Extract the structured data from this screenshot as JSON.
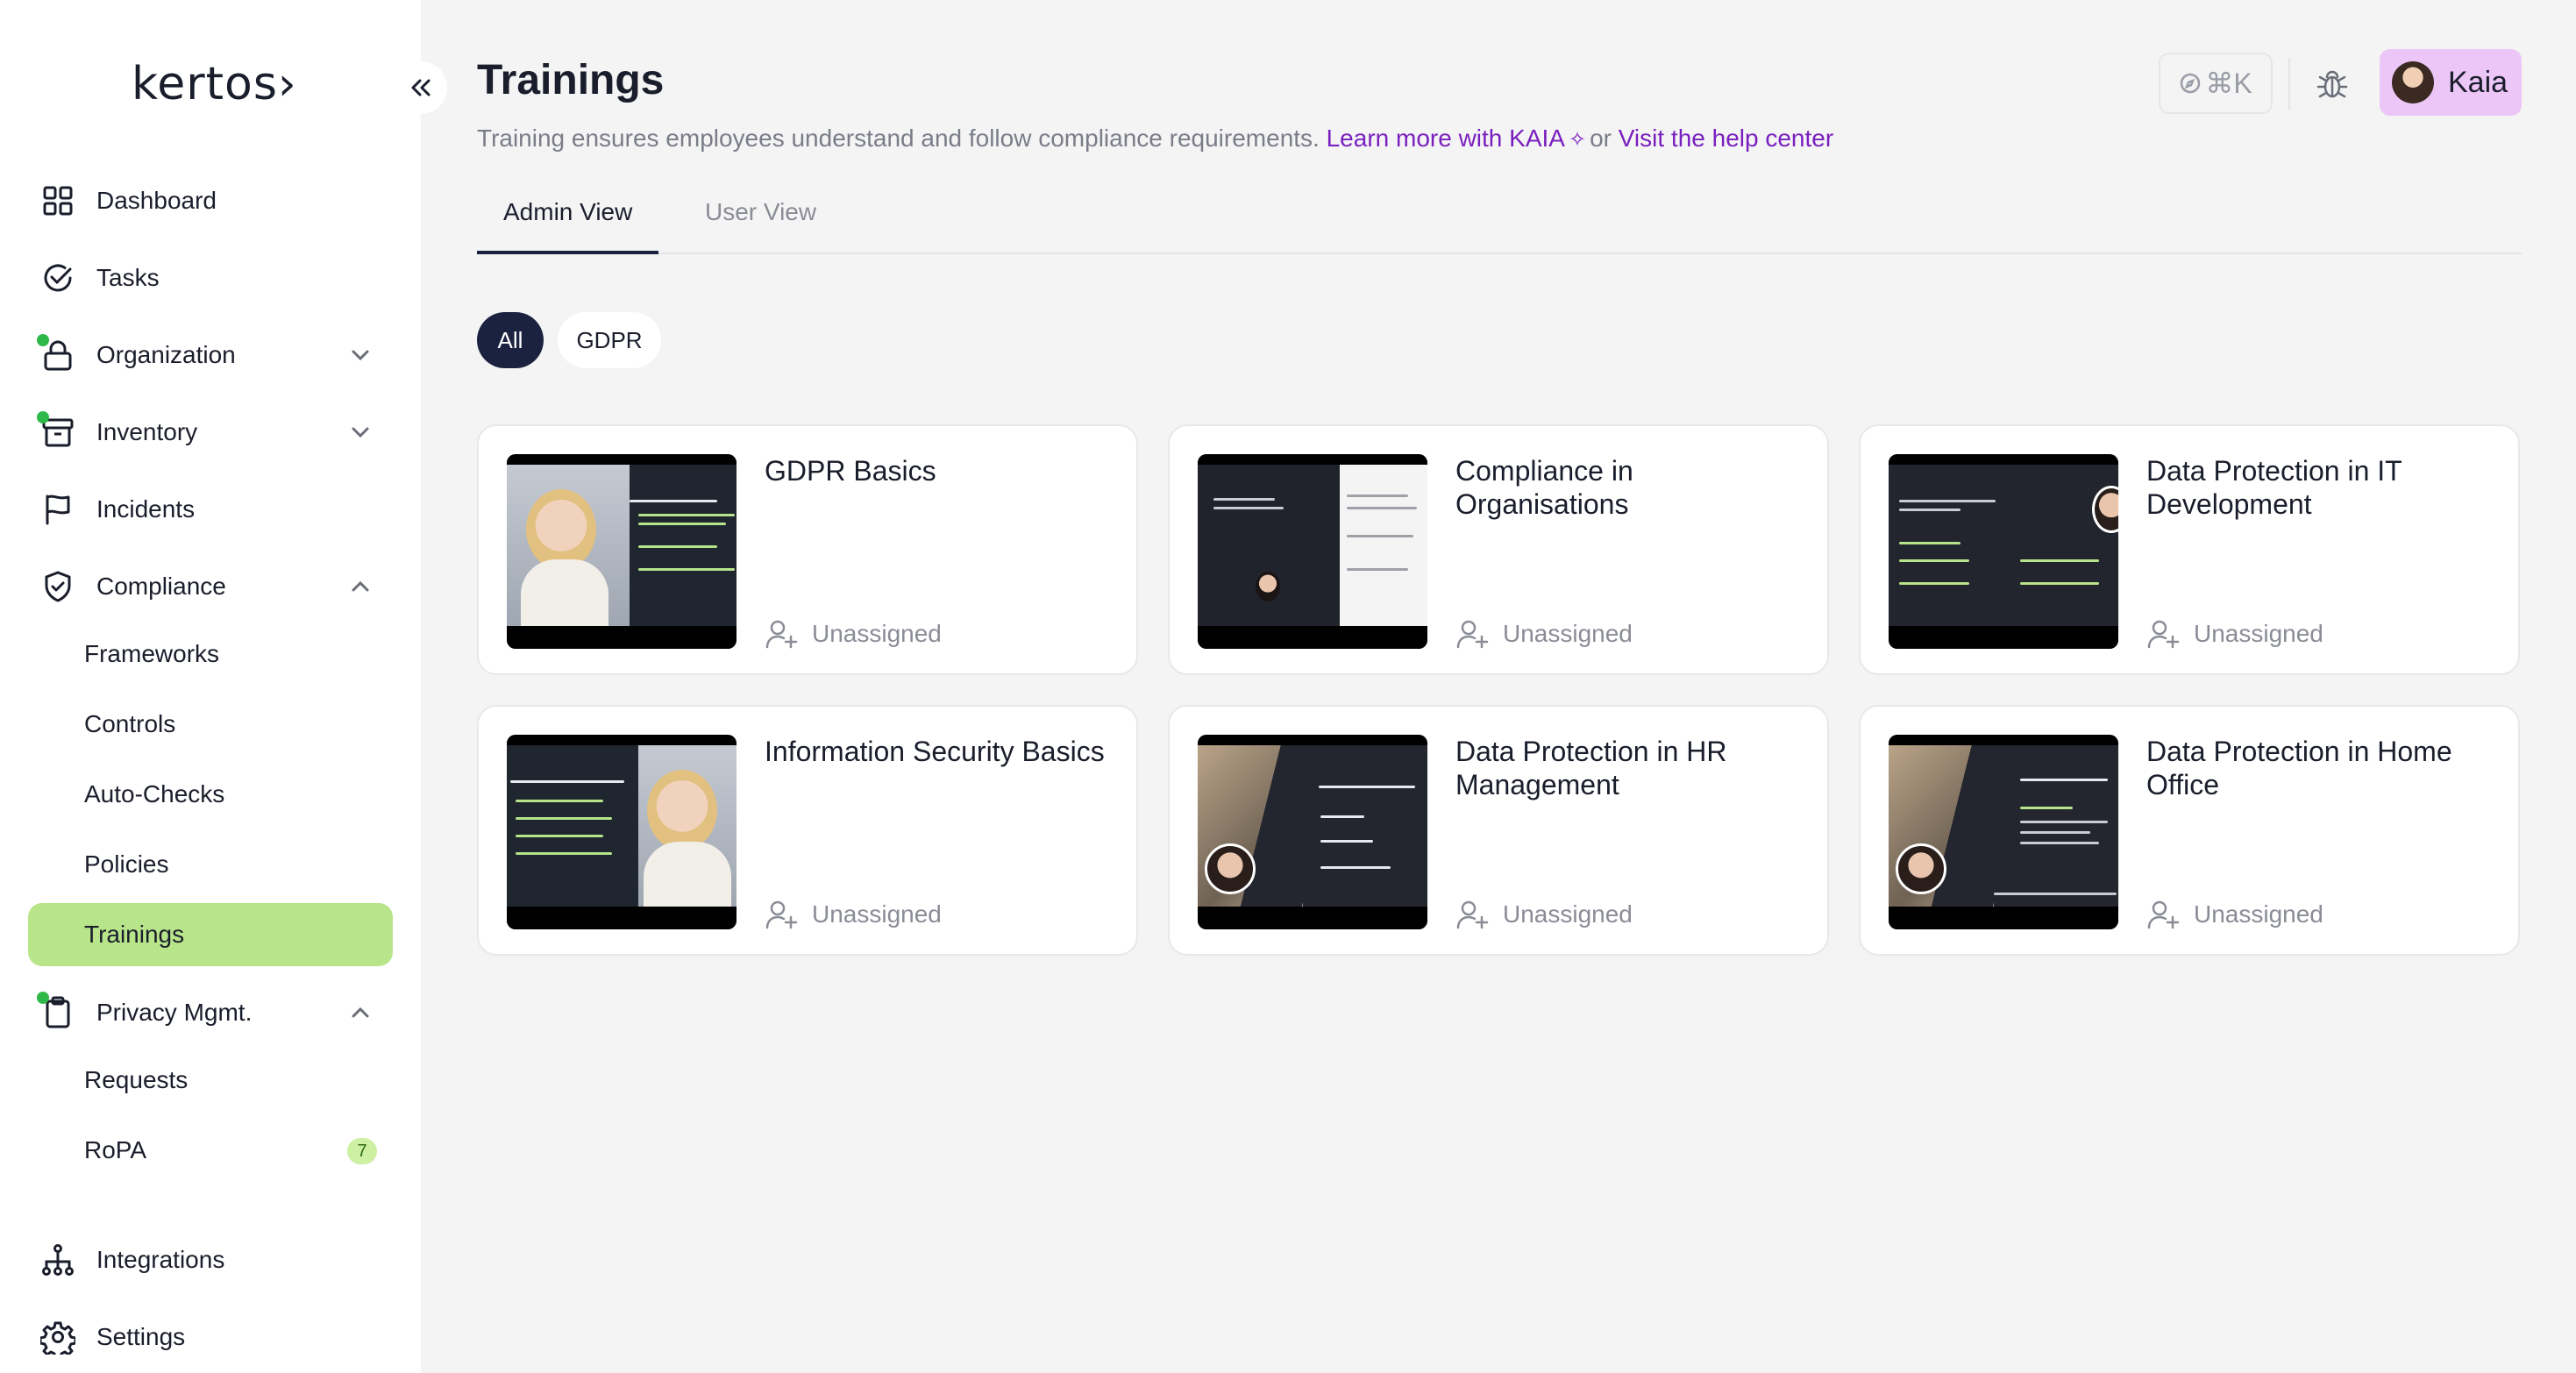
{
  "sidebar": {
    "logo": "kertos›",
    "collapse_icon": "double-chevron-left-icon",
    "items": [
      {
        "label": "Dashboard",
        "icon": "grid-icon"
      },
      {
        "label": "Tasks",
        "icon": "check-circle-icon"
      },
      {
        "label": "Organization",
        "icon": "lock-icon",
        "dot": true,
        "chevron": "down"
      },
      {
        "label": "Inventory",
        "icon": "archive-icon",
        "dot": true,
        "chevron": "down"
      },
      {
        "label": "Incidents",
        "icon": "flag-icon"
      },
      {
        "label": "Compliance",
        "icon": "shield-check-icon",
        "chevron": "up"
      },
      {
        "label": "Privacy Mgmt.",
        "icon": "clipboard-icon",
        "dot": true,
        "chevron": "up"
      },
      {
        "label": "Integrations",
        "icon": "network-icon"
      },
      {
        "label": "Settings",
        "icon": "gear-icon"
      }
    ],
    "compliance_sub": [
      "Frameworks",
      "Controls",
      "Auto-Checks",
      "Policies",
      "Trainings"
    ],
    "privacy_sub": [
      "Requests",
      "RoPA"
    ],
    "ropa_badge": "7",
    "active_item": "Trainings"
  },
  "header": {
    "title": "Trainings",
    "subtitle": "Training ensures employees understand and follow compliance requirements.",
    "learn_more": "Learn more with KAIA",
    "or": "or",
    "help_link": "Visit the help center",
    "command_shortcut": "⌘K",
    "user_name": "Kaia"
  },
  "tabs": [
    "Admin View",
    "User View"
  ],
  "filters": [
    "All",
    "GDPR"
  ],
  "cards": [
    {
      "title": "GDPR Basics",
      "status": "Unassigned"
    },
    {
      "title": "Compliance in Organisations",
      "status": "Unassigned"
    },
    {
      "title": "Data Protection in IT Development",
      "status": "Unassigned"
    },
    {
      "title": "Information Security Basics",
      "status": "Unassigned"
    },
    {
      "title": "Data Protection in HR Management",
      "status": "Unassigned"
    },
    {
      "title": "Data Protection in Home Office",
      "status": "Unassigned"
    }
  ],
  "colors": {
    "accent_link": "#7a1fbf",
    "active_nav": "#b8e58a",
    "status_dot": "#2fb84a",
    "pill_active": "#1a2240",
    "user_chip": "#ecc6f6"
  }
}
